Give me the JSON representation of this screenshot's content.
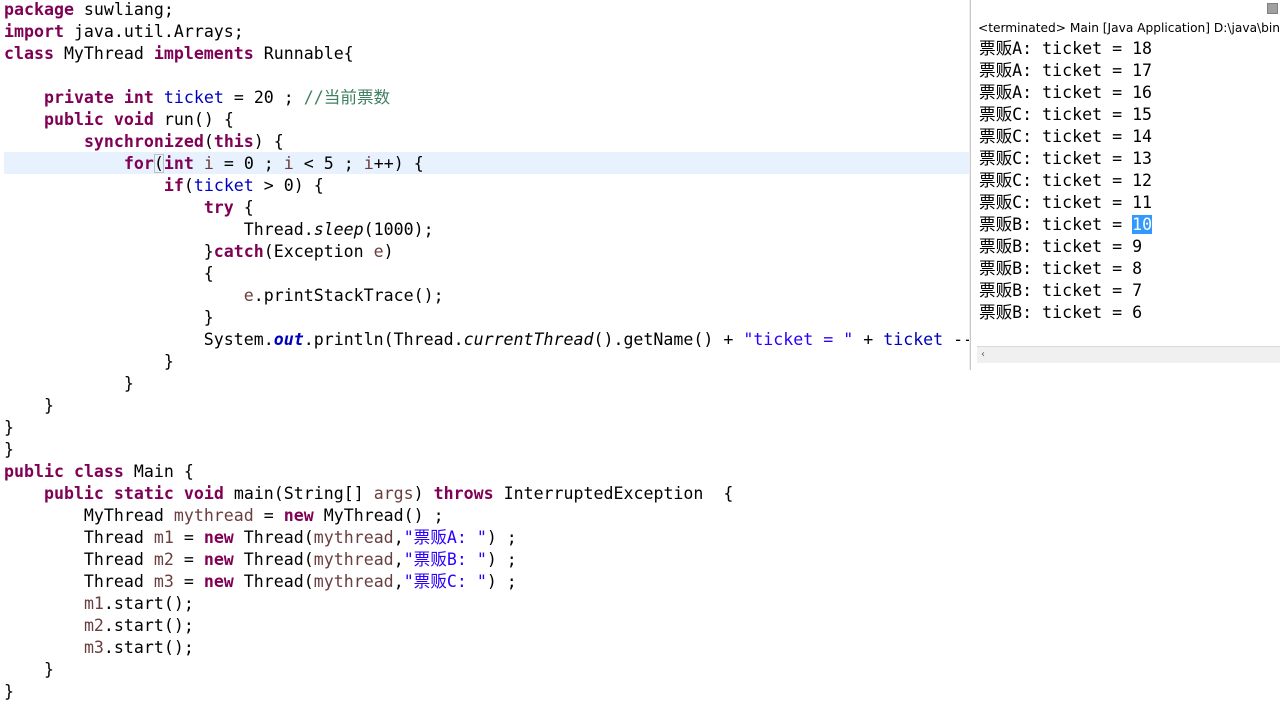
{
  "editor": {
    "lines": [
      {
        "segs": [
          {
            "t": "package",
            "c": "kw"
          },
          {
            "t": " suwliang;",
            "c": "plain"
          }
        ]
      },
      {
        "segs": [
          {
            "t": "import",
            "c": "kw"
          },
          {
            "t": " java.util.Arrays;",
            "c": "plain"
          }
        ]
      },
      {
        "segs": [
          {
            "t": "class",
            "c": "kw"
          },
          {
            "t": " MyThread ",
            "c": "plain"
          },
          {
            "t": "implements",
            "c": "kw"
          },
          {
            "t": " Runnable{",
            "c": "plain"
          }
        ]
      },
      {
        "segs": []
      },
      {
        "segs": [
          {
            "t": "    ",
            "c": "plain"
          },
          {
            "t": "private",
            "c": "kw"
          },
          {
            "t": " ",
            "c": "plain"
          },
          {
            "t": "int",
            "c": "kw"
          },
          {
            "t": " ",
            "c": "plain"
          },
          {
            "t": "ticket",
            "c": "field"
          },
          {
            "t": " = 20 ; ",
            "c": "plain"
          },
          {
            "t": "//当前票数",
            "c": "com"
          }
        ]
      },
      {
        "segs": [
          {
            "t": "    ",
            "c": "plain"
          },
          {
            "t": "public",
            "c": "kw"
          },
          {
            "t": " ",
            "c": "plain"
          },
          {
            "t": "void",
            "c": "kw"
          },
          {
            "t": " run() {",
            "c": "plain"
          }
        ]
      },
      {
        "segs": [
          {
            "t": "        ",
            "c": "plain"
          },
          {
            "t": "synchronized",
            "c": "kw"
          },
          {
            "t": "(",
            "c": "plain"
          },
          {
            "t": "this",
            "c": "kw"
          },
          {
            "t": ") {",
            "c": "plain"
          }
        ]
      },
      {
        "segs": [
          {
            "t": "            ",
            "c": "plain"
          },
          {
            "t": "for",
            "c": "kw"
          },
          {
            "t": "(",
            "c": "bracket"
          },
          {
            "t": "int",
            "c": "kw"
          },
          {
            "t": " ",
            "c": "plain"
          },
          {
            "t": "i",
            "c": "var"
          },
          {
            "t": " = 0 ; ",
            "c": "plain"
          },
          {
            "t": "i",
            "c": "var"
          },
          {
            "t": " < 5 ; ",
            "c": "plain"
          },
          {
            "t": "i",
            "c": "var"
          },
          {
            "t": "++) {",
            "c": "plain"
          }
        ]
      },
      {
        "segs": [
          {
            "t": "                ",
            "c": "plain"
          },
          {
            "t": "if",
            "c": "kw"
          },
          {
            "t": "(",
            "c": "plain"
          },
          {
            "t": "ticket",
            "c": "field"
          },
          {
            "t": " > 0) {",
            "c": "plain"
          }
        ]
      },
      {
        "segs": [
          {
            "t": "                    ",
            "c": "plain"
          },
          {
            "t": "try",
            "c": "kw"
          },
          {
            "t": " {",
            "c": "plain"
          }
        ]
      },
      {
        "segs": [
          {
            "t": "                        Thread.",
            "c": "plain"
          },
          {
            "t": "sleep",
            "c": "it"
          },
          {
            "t": "(1000);",
            "c": "plain"
          }
        ]
      },
      {
        "segs": [
          {
            "t": "                    }",
            "c": "plain"
          },
          {
            "t": "catch",
            "c": "kw"
          },
          {
            "t": "(Exception ",
            "c": "plain"
          },
          {
            "t": "e",
            "c": "var"
          },
          {
            "t": ")",
            "c": "plain"
          }
        ]
      },
      {
        "segs": [
          {
            "t": "                    {",
            "c": "plain"
          }
        ]
      },
      {
        "segs": [
          {
            "t": "                        ",
            "c": "plain"
          },
          {
            "t": "e",
            "c": "var"
          },
          {
            "t": ".printStackTrace();",
            "c": "plain"
          }
        ]
      },
      {
        "segs": [
          {
            "t": "                    }",
            "c": "plain"
          }
        ]
      },
      {
        "segs": [
          {
            "t": "                    System.",
            "c": "plain"
          },
          {
            "t": "out",
            "c": "bi"
          },
          {
            "t": ".println(Thread.",
            "c": "plain"
          },
          {
            "t": "currentThread",
            "c": "it"
          },
          {
            "t": "().getName() + ",
            "c": "plain"
          },
          {
            "t": "\"ticket = \"",
            "c": "str"
          },
          {
            "t": " + ",
            "c": "plain"
          },
          {
            "t": "ticket",
            "c": "field"
          },
          {
            "t": " --",
            "c": "plain"
          }
        ]
      },
      {
        "segs": [
          {
            "t": "                }",
            "c": "plain"
          }
        ]
      },
      {
        "segs": [
          {
            "t": "            }",
            "c": "plain"
          }
        ]
      },
      {
        "segs": [
          {
            "t": "    }",
            "c": "plain"
          }
        ]
      },
      {
        "segs": [
          {
            "t": "}",
            "c": "plain"
          }
        ]
      },
      {
        "segs": [
          {
            "t": "}",
            "c": "plain"
          }
        ]
      },
      {
        "segs": [
          {
            "t": "public",
            "c": "kw"
          },
          {
            "t": " ",
            "c": "plain"
          },
          {
            "t": "class",
            "c": "kw"
          },
          {
            "t": " Main {",
            "c": "plain"
          }
        ]
      },
      {
        "segs": [
          {
            "t": "    ",
            "c": "plain"
          },
          {
            "t": "public",
            "c": "kw"
          },
          {
            "t": " ",
            "c": "plain"
          },
          {
            "t": "static",
            "c": "kw"
          },
          {
            "t": " ",
            "c": "plain"
          },
          {
            "t": "void",
            "c": "kw"
          },
          {
            "t": " main(String[] ",
            "c": "plain"
          },
          {
            "t": "args",
            "c": "var"
          },
          {
            "t": ") ",
            "c": "plain"
          },
          {
            "t": "throws",
            "c": "kw"
          },
          {
            "t": " InterruptedException  {",
            "c": "plain"
          }
        ]
      },
      {
        "segs": [
          {
            "t": "        MyThread ",
            "c": "plain"
          },
          {
            "t": "mythread",
            "c": "var"
          },
          {
            "t": " = ",
            "c": "plain"
          },
          {
            "t": "new",
            "c": "kw"
          },
          {
            "t": " MyThread() ;",
            "c": "plain"
          }
        ]
      },
      {
        "segs": [
          {
            "t": "        Thread ",
            "c": "plain"
          },
          {
            "t": "m1",
            "c": "var"
          },
          {
            "t": " = ",
            "c": "plain"
          },
          {
            "t": "new",
            "c": "kw"
          },
          {
            "t": " Thread(",
            "c": "plain"
          },
          {
            "t": "mythread",
            "c": "var"
          },
          {
            "t": ",",
            "c": "plain"
          },
          {
            "t": "\"票贩A: \"",
            "c": "str"
          },
          {
            "t": ") ;",
            "c": "plain"
          }
        ]
      },
      {
        "segs": [
          {
            "t": "        Thread ",
            "c": "plain"
          },
          {
            "t": "m2",
            "c": "var"
          },
          {
            "t": " = ",
            "c": "plain"
          },
          {
            "t": "new",
            "c": "kw"
          },
          {
            "t": " Thread(",
            "c": "plain"
          },
          {
            "t": "mythread",
            "c": "var"
          },
          {
            "t": ",",
            "c": "plain"
          },
          {
            "t": "\"票贩B: \"",
            "c": "str"
          },
          {
            "t": ") ;",
            "c": "plain"
          }
        ]
      },
      {
        "segs": [
          {
            "t": "        Thread ",
            "c": "plain"
          },
          {
            "t": "m3",
            "c": "var"
          },
          {
            "t": " = ",
            "c": "plain"
          },
          {
            "t": "new",
            "c": "kw"
          },
          {
            "t": " Thread(",
            "c": "plain"
          },
          {
            "t": "mythread",
            "c": "var"
          },
          {
            "t": ",",
            "c": "plain"
          },
          {
            "t": "\"票贩C: \"",
            "c": "str"
          },
          {
            "t": ") ;",
            "c": "plain"
          }
        ]
      },
      {
        "segs": [
          {
            "t": "        ",
            "c": "plain"
          },
          {
            "t": "m1",
            "c": "var"
          },
          {
            "t": ".start();",
            "c": "plain"
          }
        ]
      },
      {
        "segs": [
          {
            "t": "        ",
            "c": "plain"
          },
          {
            "t": "m2",
            "c": "var"
          },
          {
            "t": ".start();",
            "c": "plain"
          }
        ]
      },
      {
        "segs": [
          {
            "t": "        ",
            "c": "plain"
          },
          {
            "t": "m3",
            "c": "var"
          },
          {
            "t": ".start();",
            "c": "plain"
          }
        ]
      },
      {
        "segs": [
          {
            "t": "    }",
            "c": "plain"
          }
        ]
      },
      {
        "segs": [
          {
            "t": "}",
            "c": "plain"
          }
        ]
      }
    ]
  },
  "console": {
    "title": "<terminated> Main [Java Application] D:\\java\\bin\\javaw.exe",
    "lines": [
      {
        "text": "票贩A: ticket = 18"
      },
      {
        "text": "票贩A: ticket = 17"
      },
      {
        "text": "票贩A: ticket = 16"
      },
      {
        "text": "票贩C: ticket = 15"
      },
      {
        "text": "票贩C: ticket = 14"
      },
      {
        "text": "票贩C: ticket = 13"
      },
      {
        "text": "票贩C: ticket = 12"
      },
      {
        "text": "票贩C: ticket = 11"
      },
      {
        "text": "票贩B: ticket = ",
        "sel": "10"
      },
      {
        "text": "票贩B: ticket = 9"
      },
      {
        "text": "票贩B: ticket = 8"
      },
      {
        "text": "票贩B: ticket = 7"
      },
      {
        "text": "票贩B: ticket = 6"
      }
    ],
    "scroll_left_glyph": "‹"
  },
  "colors": {
    "keyword": "#7f0055",
    "field": "#0000c0",
    "string": "#2a00ff",
    "comment": "#3f7f5f",
    "local_var": "#6a3e3e",
    "current_line": "#e8f2fe",
    "selection": "#3399ff"
  }
}
